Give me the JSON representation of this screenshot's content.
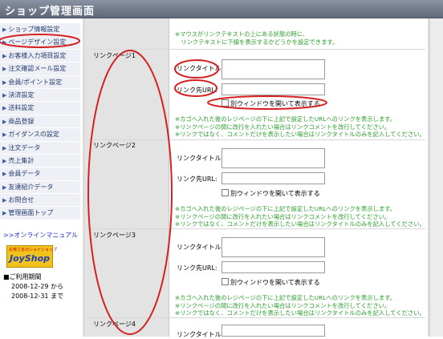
{
  "app": {
    "title": "ショップ管理画面"
  },
  "sidebar": {
    "items": [
      {
        "label": "ショップ情報設定"
      },
      {
        "label": "ページデザイン設定"
      },
      {
        "label": "お客様入力項目設定"
      },
      {
        "label": "注文確認メール設定"
      },
      {
        "label": "会員/ポイント設定"
      },
      {
        "label": "決済設定"
      },
      {
        "label": "送料設定"
      },
      {
        "label": "商品登録"
      },
      {
        "label": "ガイダンスの設定"
      },
      {
        "label": "注文データ"
      },
      {
        "label": "売上集計"
      },
      {
        "label": "会員データ"
      },
      {
        "label": "友達紹介データ"
      },
      {
        "label": "お問合せ"
      },
      {
        "label": "管理画面トップ"
      }
    ],
    "manual_link": ">>オンラインマニュアル",
    "logo": {
      "small": "お喋さまのショイショップ",
      "brand": "JoyShop"
    },
    "period": {
      "title": "■ご利用期間",
      "start": "2008-12-29",
      "start_suffix": "から",
      "end": "2008-12-31",
      "end_suffix": "まで"
    }
  },
  "main": {
    "top_note": "※マウスがリンクテキストの上にある状態の時に、\n　リンクテキストに下線を表示するかどうかを設定できます。",
    "sections": [
      {
        "label": "リンクページ1",
        "title_label": "リンクタイトル:",
        "url_label": "リンク先URL:",
        "checkbox_label": "別ウィンドウを開いて表示する",
        "note": "※カゴへ入れた後のレジページの下に上記で設定したURLへのリンクを表示します。\n※リンクページの間に改行を入れたい場合はリンクコメントを改行してください。\n※リンクではなく、コメントだけを表示したい場合はリンクタイトルのみを記入してください。"
      },
      {
        "label": "リンクページ2",
        "title_label": "リンクタイトル:",
        "url_label": "リンク先URL:",
        "checkbox_label": "別ウィンドウを開いて表示する",
        "note": "※カゴへ入れた後のレジページの下に上記で設定したURLへのリンクを表示します。\n※リンクページの間に改行を入れたい場合はリンクコメントを改行してください。\n※リンクではなく、コメントだけを表示したい場合はリンクタイトルのみを記入してください。"
      },
      {
        "label": "リンクページ3",
        "title_label": "リンクタイトル:",
        "url_label": "リンク先URL:",
        "checkbox_label": "別ウィンドウを開いて表示する",
        "note": "※カゴへ入れた後のレジページの下に上記で設定したURLへのリンクを表示します。\n※リンクページの間に改行を入れたい場合はリンクコメントを改行してください。\n※リンクではなく、コメントだけを表示したい場合はリンクタイトルのみを記入してください。"
      },
      {
        "label": "リンクページ4",
        "title_label": "リンクタイトル:"
      }
    ]
  },
  "colors": {
    "annotation": "#d42020",
    "note_text": "#2aa02a",
    "menu_text": "#223a70"
  }
}
